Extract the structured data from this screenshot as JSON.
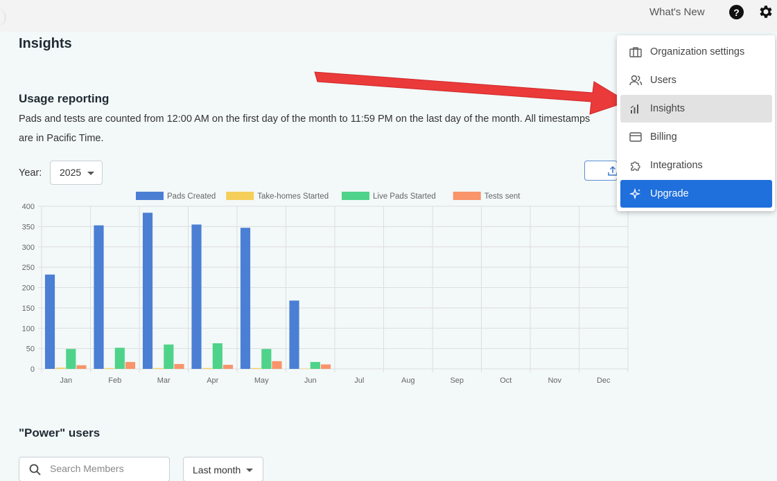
{
  "topbar": {
    "whats_new": "What's New",
    "help_glyph": "?"
  },
  "page": {
    "title": "Insights",
    "usage_title": "Usage reporting",
    "usage_desc": "Pads and tests are counted from 12:00 AM on the first day of the month to 11:59 PM on the last day of the month. All timestamps are in Pacific Time.",
    "year_label": "Year:",
    "year_value": "2025"
  },
  "power_users": {
    "title": "\"Power\" users",
    "search_placeholder": "Search Members",
    "period_value": "Last month"
  },
  "menu": {
    "items": [
      {
        "label": "Organization settings",
        "icon": "briefcase-icon"
      },
      {
        "label": "Users",
        "icon": "users-icon"
      },
      {
        "label": "Insights",
        "icon": "bar-chart-icon"
      },
      {
        "label": "Billing",
        "icon": "credit-card-icon"
      },
      {
        "label": "Integrations",
        "icon": "puzzle-icon"
      },
      {
        "label": "Upgrade",
        "icon": "sparkle-icon"
      }
    ]
  },
  "colors": {
    "pads_created": "#4a7fd4",
    "take_homes": "#f5cf5a",
    "live_pads": "#4fd38a",
    "tests_sent": "#f9946b",
    "upgrade": "#1f6fdc",
    "arrow": "#ea3a3a"
  },
  "chart_data": {
    "type": "bar",
    "categories": [
      "Jan",
      "Feb",
      "Mar",
      "Apr",
      "May",
      "Jun",
      "Jul",
      "Aug",
      "Sep",
      "Oct",
      "Nov",
      "Dec"
    ],
    "series": [
      {
        "name": "Pads Created",
        "values": [
          232,
          353,
          384,
          355,
          347,
          168,
          0,
          0,
          0,
          0,
          0,
          0
        ]
      },
      {
        "name": "Take-homes Started",
        "values": [
          3,
          2,
          2,
          2,
          2,
          1,
          0,
          0,
          0,
          0,
          0,
          0
        ]
      },
      {
        "name": "Live Pads Started",
        "values": [
          49,
          52,
          60,
          63,
          49,
          17,
          0,
          0,
          0,
          0,
          0,
          0
        ]
      },
      {
        "name": "Tests sent",
        "values": [
          9,
          17,
          12,
          10,
          19,
          11,
          0,
          0,
          0,
          0,
          0,
          0
        ]
      }
    ],
    "yticks": [
      "0",
      "50",
      "100",
      "150",
      "200",
      "250",
      "300",
      "350",
      "400"
    ],
    "ylim": [
      0,
      400
    ],
    "grid": true,
    "legend": "top"
  }
}
